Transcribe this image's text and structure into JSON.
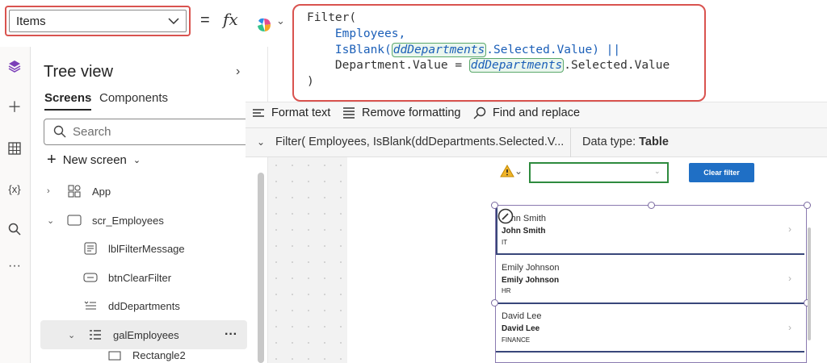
{
  "formula_bar": {
    "property": "Items",
    "equals": "=",
    "fx": "fx",
    "code": {
      "line1": "Filter(",
      "line2": "Employees,",
      "line3_fn": "IsBlank(",
      "line3_param": "ddDepartments",
      "line3_rest": ".Selected.Value) ||",
      "line4_left": "Department.Value = ",
      "line4_param": "ddDepartments",
      "line4_rest": ".Selected.Value",
      "line5": ")"
    }
  },
  "toolbar": {
    "format_text": "Format text",
    "remove_formatting": "Remove formatting",
    "find_replace": "Find and replace"
  },
  "subbar": {
    "formula_preview": "Filter( Employees, IsBlank(ddDepartments.Selected.V...",
    "data_type_label": "Data type:",
    "data_type_value": "Table"
  },
  "tree_view": {
    "title": "Tree view",
    "tabs": [
      "Screens",
      "Components"
    ],
    "search_placeholder": "Search",
    "new_screen": "New screen",
    "items": [
      {
        "label": "App",
        "icon": "app-icon"
      },
      {
        "label": "scr_Employees",
        "icon": "screen-icon"
      },
      {
        "label": "lblFilterMessage",
        "icon": "label-icon"
      },
      {
        "label": "btnClearFilter",
        "icon": "button-icon"
      },
      {
        "label": "ddDepartments",
        "icon": "dropdown-icon"
      },
      {
        "label": "galEmployees",
        "icon": "gallery-icon",
        "more": "···"
      },
      {
        "label": "Rectangle2",
        "icon": "rectangle-icon"
      }
    ]
  },
  "canvas": {
    "clear_filter": "Clear filter",
    "employees": [
      {
        "name": "John Smith",
        "name2": "John Smith",
        "dept": "IT"
      },
      {
        "name": "Emily Johnson",
        "name2": "Emily Johnson",
        "dept": "HR"
      },
      {
        "name": "David Lee",
        "name2": "David Lee",
        "dept": "FINANCE"
      }
    ]
  },
  "colors": {
    "highlight_border": "#d9534f",
    "accent_blue": "#1f6fc5",
    "dropdown_border": "#2e8b3e"
  }
}
